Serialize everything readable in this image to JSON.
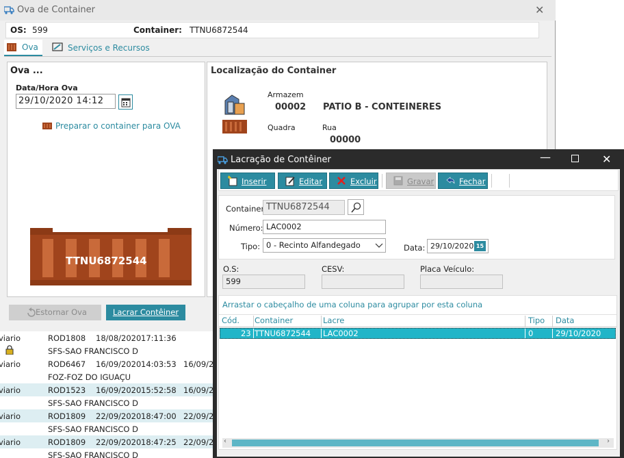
{
  "bg_rows": [
    {
      "c1": "viario",
      "c2": "ROD1808",
      "c3": "18/08/2020",
      "c4": "17:11:36",
      "c5": "",
      "alt": false
    },
    {
      "c1": "",
      "c2": "SFS-SAO FRANCISCO D",
      "c3": "",
      "c4": "",
      "c5": "",
      "alt": false,
      "lock": true
    },
    {
      "c1": "viario",
      "c2": "ROD6467",
      "c3": "16/09/2020",
      "c4": "14:03:53",
      "c5": "16/09/20",
      "alt": false
    },
    {
      "c1": "",
      "c2": "FOZ-FOZ DO IGUAÇU",
      "c3": "",
      "c4": "",
      "c5": "",
      "alt": false
    },
    {
      "c1": "viario",
      "c2": "ROD1523",
      "c3": "16/09/2020",
      "c4": "15:52:58",
      "c5": "16/09/20",
      "alt": true
    },
    {
      "c1": "",
      "c2": "SFS-SAO FRANCISCO D",
      "c3": "",
      "c4": "",
      "c5": "",
      "alt": false
    },
    {
      "c1": "viario",
      "c2": "ROD1809",
      "c3": "22/09/2020",
      "c4": "18:47:00",
      "c5": "22/09/20",
      "alt": true
    },
    {
      "c1": "",
      "c2": "SFS-SAO FRANCISCO D",
      "c3": "",
      "c4": "",
      "c5": "",
      "alt": false
    },
    {
      "c1": "viario",
      "c2": "ROD1809",
      "c3": "22/09/2020",
      "c4": "18:47:25",
      "c5": "22/09/20",
      "alt": true
    },
    {
      "c1": "",
      "c2": "SFS-SAO FRANCISCO D",
      "c3": "",
      "c4": "",
      "c5": "",
      "alt": false
    }
  ],
  "win1": {
    "title": "Ova de Container",
    "os_label": "OS:",
    "os_value": "599",
    "container_label": "Container:",
    "container_value": "TTNU6872544",
    "tabs": [
      "Ova",
      "Serviços e Recursos"
    ],
    "ova_panel_title": "Ova ...",
    "datetime_label": "Data/Hora Ova",
    "datetime_value": "29/10/2020 14:12",
    "prepare_link": "Preparar o container para OVA",
    "prepare_underline_char": "O",
    "container_graphic_label": "TTNU6872544",
    "loc_panel_title": "Localização do Container",
    "armazem_label": "Armazem",
    "armazem_code": "00002",
    "armazem_name": "PATIO B - CONTEINERES",
    "quadra_label": "Quadra",
    "rua_label": "Rua",
    "rua_value": "00000",
    "estornar_button": "Estornar Ova",
    "lacrar_button": "Lacrar Contêiner"
  },
  "win2": {
    "title": "Lacração de Contêiner",
    "toolbar": {
      "inserir": "Inserir",
      "editar": "Editar",
      "excluir": "Excluir",
      "gravar": "Gravar",
      "fechar": "Fechar"
    },
    "container_label": "Container:",
    "container_value": "TTNU6872544",
    "numero_label": "Número:",
    "numero_value": "LAC0002",
    "tipo_label": "Tipo:",
    "tipo_value": "0 - Recinto Alfandegado",
    "data_label": "Data:",
    "data_value": "29/10/2020",
    "calendar_day": "15",
    "os_label": "O.S:",
    "os_value": "599",
    "cesv_label": "CESV:",
    "cesv_value": "",
    "placa_label": "Placa Veículo:",
    "placa_value": "",
    "group_hint": "Arrastar o cabeçalho de uma coluna para agrupar por esta coluna",
    "columns": [
      "Cód.",
      "Container",
      "Lacre",
      "Tipo",
      "Data"
    ],
    "rows": [
      {
        "cod": "23",
        "container": "TTNU6872544",
        "lacre": "LAC0002",
        "tipo": "0",
        "data": "29/10/2020"
      }
    ]
  },
  "colors": {
    "accent": "#2c8ba0",
    "selected_row": "#21b5c8",
    "container_brown": "#a0441c",
    "dark_frame": "#2b2b2b"
  }
}
